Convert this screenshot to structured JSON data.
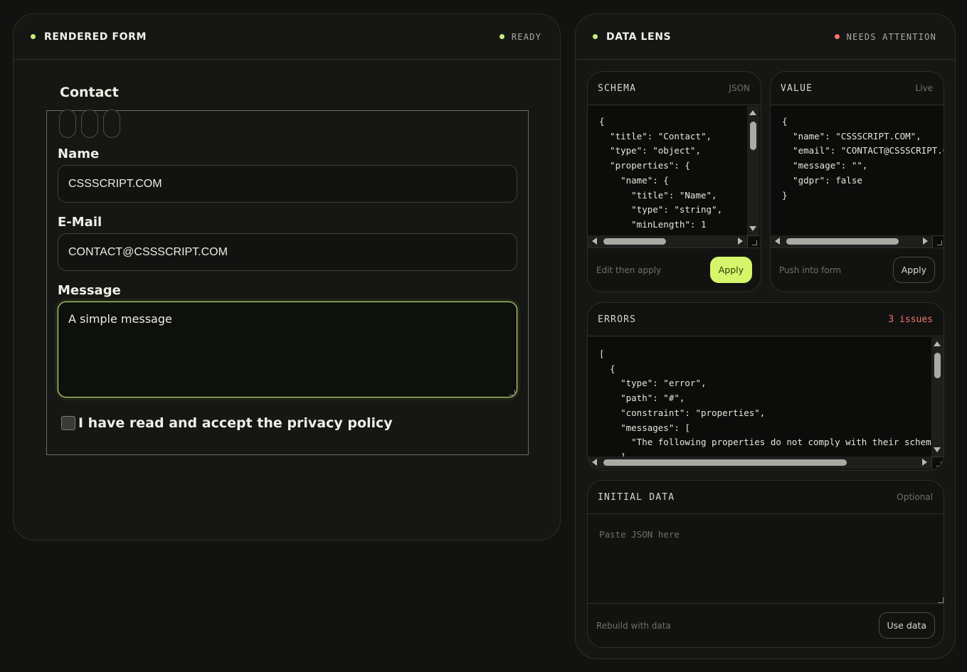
{
  "left_panel": {
    "title": "RENDERED FORM",
    "status": "READY",
    "form": {
      "legend": "Contact",
      "name_label": "Name",
      "name_value": "CSSSCRIPT.COM",
      "email_label": "E-Mail",
      "email_value": "CONTACT@CSSSCRIPT.COM",
      "message_label": "Message",
      "message_value": "A simple message",
      "privacy_label": "I have read and accept the privacy policy",
      "privacy_checked": false
    }
  },
  "right_panel": {
    "title": "DATA LENS",
    "status": "NEEDS ATTENTION",
    "schema": {
      "title": "SCHEMA",
      "meta": "JSON",
      "lines": [
        "{",
        "  \"title\": \"Contact\",",
        "  \"type\": \"object\",",
        "  \"properties\": {",
        "    \"name\": {",
        "      \"title\": \"Name\",",
        "      \"type\": \"string\",",
        "      \"minLength\": 1"
      ],
      "hint": "Edit then apply",
      "button": "Apply"
    },
    "value": {
      "title": "VALUE",
      "meta": "Live",
      "lines": [
        "{",
        "  \"name\": \"CSSSCRIPT.COM\",",
        "  \"email\": \"CONTACT@CSSSCRIPT.C",
        "  \"message\": \"\",",
        "  \"gdpr\": false",
        "}"
      ],
      "hint": "Push into form",
      "button": "Apply"
    },
    "errors": {
      "title": "ERRORS",
      "meta": "3 issues",
      "lines": [
        "[",
        "  {",
        "    \"type\": \"error\",",
        "    \"path\": \"#\",",
        "    \"constraint\": \"properties\",",
        "    \"messages\": [",
        "      \"The following properties do not comply with their schem",
        "    ]"
      ]
    },
    "initial_data": {
      "title": "INITIAL DATA",
      "meta": "Optional",
      "placeholder": "Paste JSON here",
      "hint": "Rebuild with data",
      "button": "Use data"
    }
  }
}
